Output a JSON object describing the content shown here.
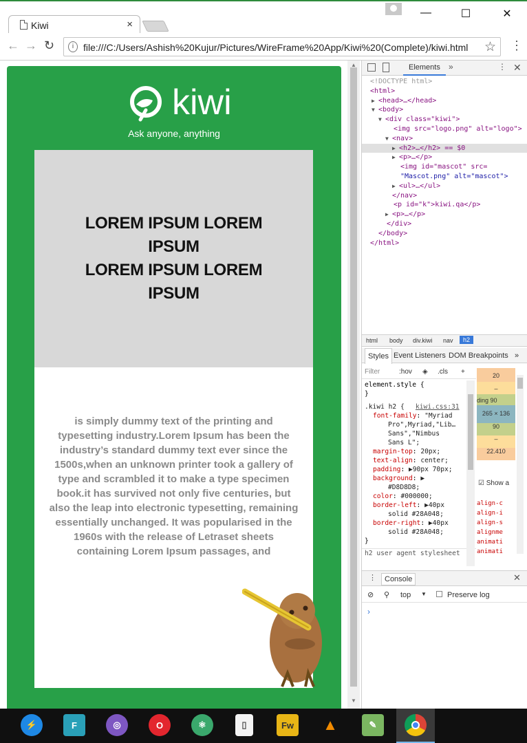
{
  "browser": {
    "tab_title": "Kiwi",
    "tab_close": "×",
    "url": "file:///C:/Users/Ashish%20Kujur/Pictures/WireFrame%20App/Kiwi%20(Complete)/kiwi.html",
    "window_controls": {
      "minimize": "—",
      "maximize": "☐",
      "close": "✕"
    },
    "nav": {
      "back": "←",
      "forward": "→",
      "reload": "↻"
    }
  },
  "page": {
    "brand": "kiwi",
    "tagline": "Ask anyone, anything",
    "hero_line1": "LOREM IPSUM LOREM IPSUM",
    "hero_line2": "LOREM IPSUM LOREM IPSUM",
    "body_text": "is simply dummy text of the printing and typesetting industry.Lorem Ipsum has been the industry’s standard dummy text ever since the 1500s,when an unknown printer took a gallery of type and scrambled it to make a type specimen book.it has survived not only five centuries, but also the leap into electronic typesetting, remaining essentially unchanged. It was popularised in the 1960s with the release of Letraset sheets containing Lorem Ipsum passages, and",
    "colors": {
      "green": "#28A048",
      "hero_bg": "#D8D8D8"
    }
  },
  "devtools": {
    "tab_elements": "Elements",
    "more": "»",
    "dom": [
      "<!DOCTYPE html>",
      "<html>",
      "<head>…</head>",
      "<body>",
      "<div class=\"kiwi\">",
      "<img src=\"logo.png\" alt=\"logo\">",
      "<nav>",
      "<h2>…</h2> == $0",
      "<p>…</p>",
      "<img id=\"mascot\" src=",
      "\"Mascot.png\" alt=\"mascot\">",
      "<ul>…</ul>",
      "</nav>",
      "<p id=\"k\">kiwi.qa</p>",
      "<p>…</p>",
      "</div>",
      "</body>",
      "</html>"
    ],
    "breadcrumbs": [
      "html",
      "body",
      "div.kiwi",
      "nav",
      "h2"
    ],
    "subtabs": [
      "Styles",
      "Event Listeners",
      "DOM Breakpoints"
    ],
    "filter": "Filter",
    "hov": ":hov",
    "cls": ".cls",
    "plus": "+",
    "element_style": "element.style {",
    "close_brace": "}",
    "rule_selector": ".kiwi h2 {",
    "rule_source": "kiwi.css:31",
    "declarations": [
      {
        "prop": "font-family",
        "val": "\"Myriad"
      },
      {
        "prop": "",
        "val": "Pro\",Myriad,\"Lib…"
      },
      {
        "prop": "",
        "val": "Sans\",\"Nimbus"
      },
      {
        "prop": "",
        "val": "Sans L\";"
      },
      {
        "prop": "margin-top",
        "val": "20px;"
      },
      {
        "prop": "text-align",
        "val": "center;"
      },
      {
        "prop": "padding",
        "val": "▶90px 70px;"
      },
      {
        "prop": "background",
        "val": "▶"
      },
      {
        "prop": "",
        "val": "#D8D8D8;"
      },
      {
        "prop": "color",
        "val": "#000000;"
      },
      {
        "prop": "border-left",
        "val": "▶40px"
      },
      {
        "prop": "",
        "val": "solid #28A048;"
      },
      {
        "prop": "border-right",
        "val": "▶40px"
      },
      {
        "prop": "",
        "val": "solid #28A048;"
      }
    ],
    "ua_rule": "h2 user agent stylesheet",
    "box_model": {
      "margin_top": "20",
      "border_top": "–",
      "padding_top": "90",
      "padding_left_label": "ding",
      "content": "265 × 136",
      "padding_bottom": "90",
      "border_bottom": "–",
      "margin_bottom": "22.410"
    },
    "show_all": "Show a",
    "computed": [
      "align-c",
      "align-i",
      "align-s",
      "alignme",
      "animati",
      "animati"
    ],
    "console_tab": "Console",
    "console_context": "top",
    "preserve_log": "Preserve log",
    "prompt": "›"
  },
  "taskbar": [
    "app-lightning",
    "app-f",
    "app-tor",
    "app-opera",
    "app-atom",
    "app-file",
    "app-fireworks",
    "app-vlc",
    "app-notepad",
    "app-chrome"
  ]
}
